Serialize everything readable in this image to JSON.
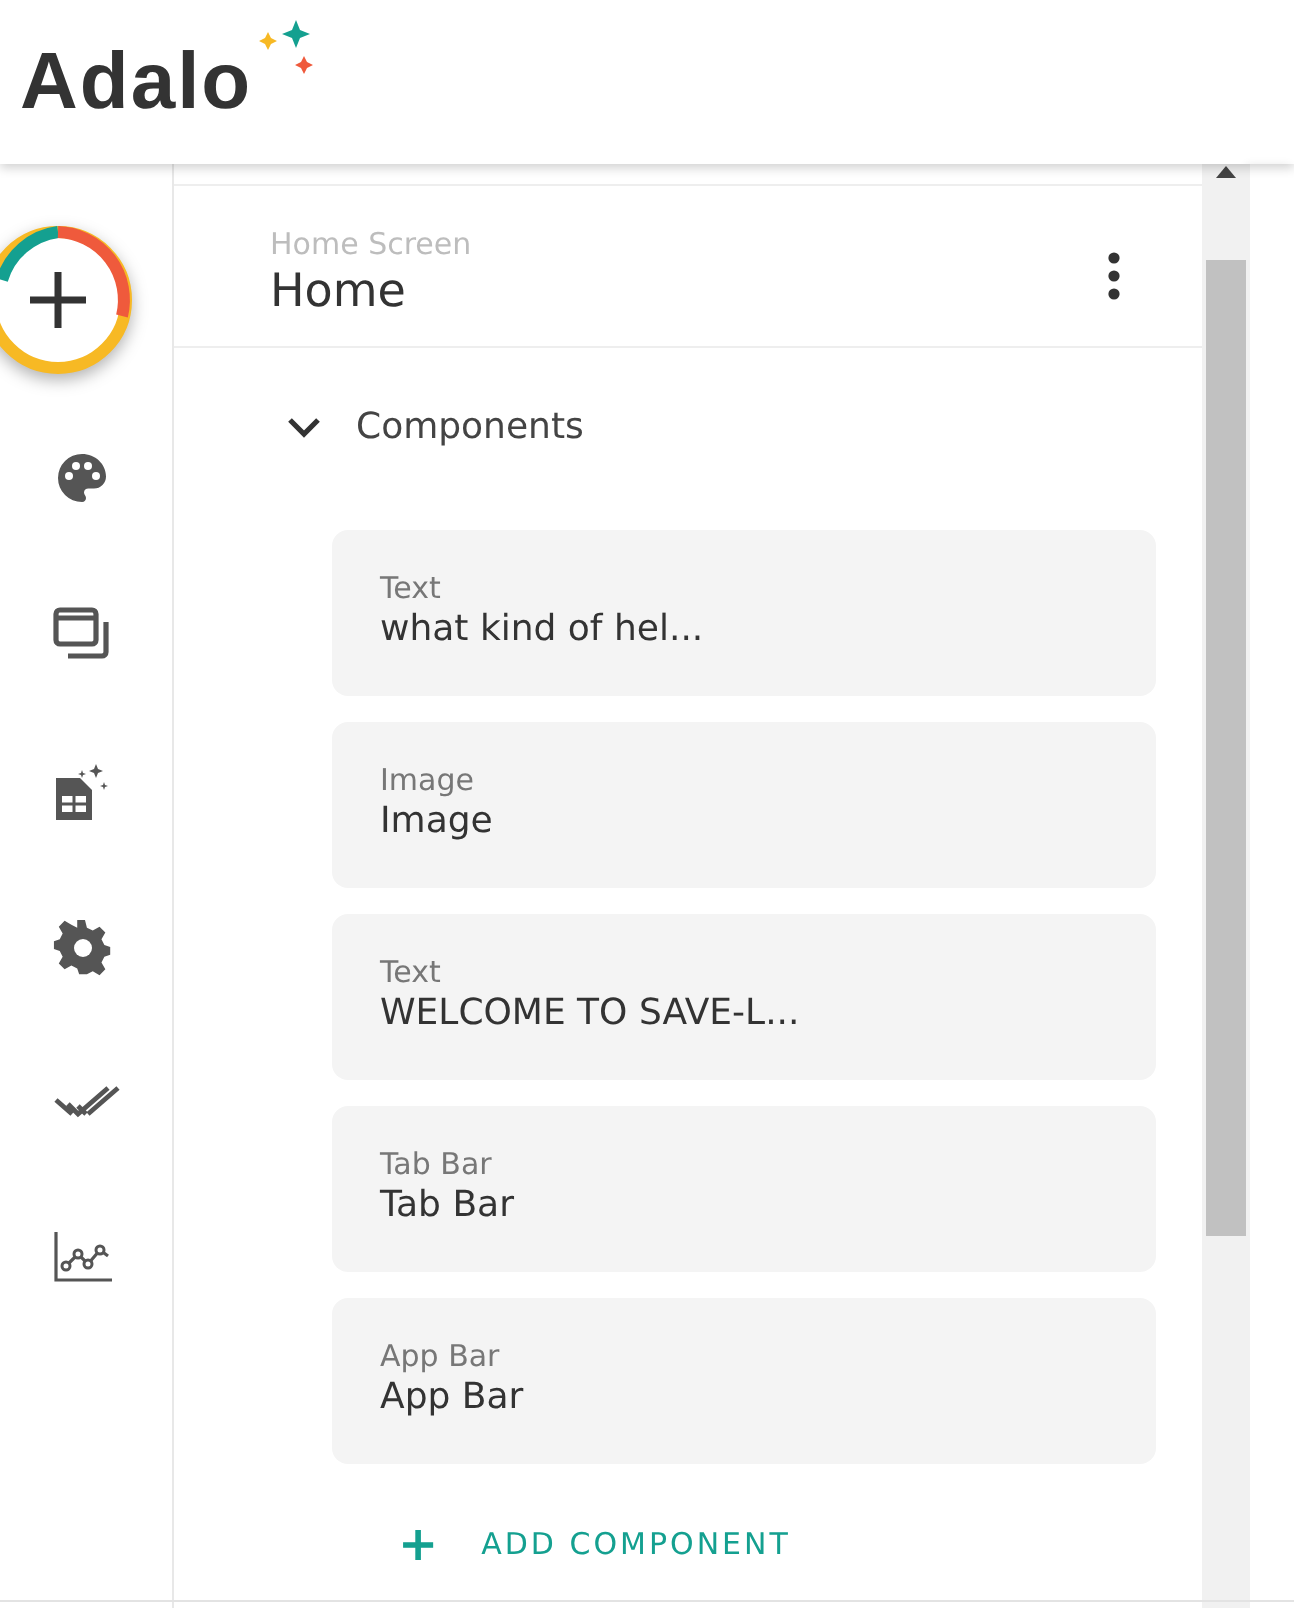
{
  "logo": {
    "text": "Adalo"
  },
  "screen": {
    "caption": "Home Screen",
    "title": "Home"
  },
  "section": {
    "title": "Components",
    "expanded": true
  },
  "components": [
    {
      "type": "Text",
      "name": "what kind of hel..."
    },
    {
      "type": "Image",
      "name": "Image"
    },
    {
      "type": "Text",
      "name": "WELCOME TO SAVE-L..."
    },
    {
      "type": "Tab Bar",
      "name": "Tab Bar"
    },
    {
      "type": "App Bar",
      "name": "App Bar"
    }
  ],
  "add_button": {
    "icon": "+",
    "label": "ADD COMPONENT"
  },
  "sidebar": [
    {
      "kind": "palette"
    },
    {
      "kind": "screens"
    },
    {
      "kind": "database"
    },
    {
      "kind": "settings"
    },
    {
      "kind": "publish"
    },
    {
      "kind": "analytics"
    }
  ]
}
